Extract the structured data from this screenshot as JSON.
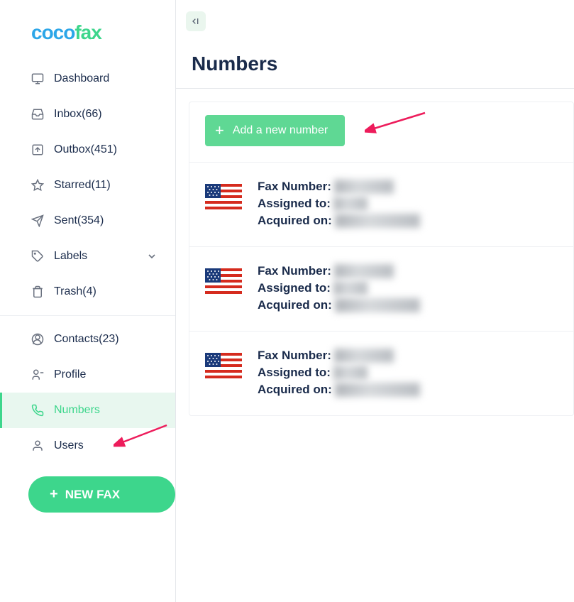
{
  "brand": {
    "part1": "coco",
    "part2": "fax"
  },
  "sidebar": {
    "items": [
      {
        "label": "Dashboard"
      },
      {
        "label": "Inbox(66)"
      },
      {
        "label": "Outbox(451)"
      },
      {
        "label": "Starred(11)"
      },
      {
        "label": "Sent(354)"
      },
      {
        "label": "Labels"
      },
      {
        "label": "Trash(4)"
      },
      {
        "label": "Contacts(23)"
      },
      {
        "label": "Profile"
      },
      {
        "label": "Numbers"
      },
      {
        "label": "Users"
      }
    ]
  },
  "new_fax_label": "NEW FAX",
  "page_title": "Numbers",
  "add_button_label": "Add a new number",
  "field_labels": {
    "fax_number": "Fax Number:",
    "assigned_to": "Assigned to:",
    "acquired_on": "Acquired on:"
  },
  "numbers": [
    {
      "fax_number": "███████",
      "assigned_to": "████",
      "acquired_on": "██████████"
    },
    {
      "fax_number": "███████",
      "assigned_to": "████",
      "acquired_on": "██████████"
    },
    {
      "fax_number": "███████",
      "assigned_to": "████",
      "acquired_on": "██████████"
    }
  ]
}
